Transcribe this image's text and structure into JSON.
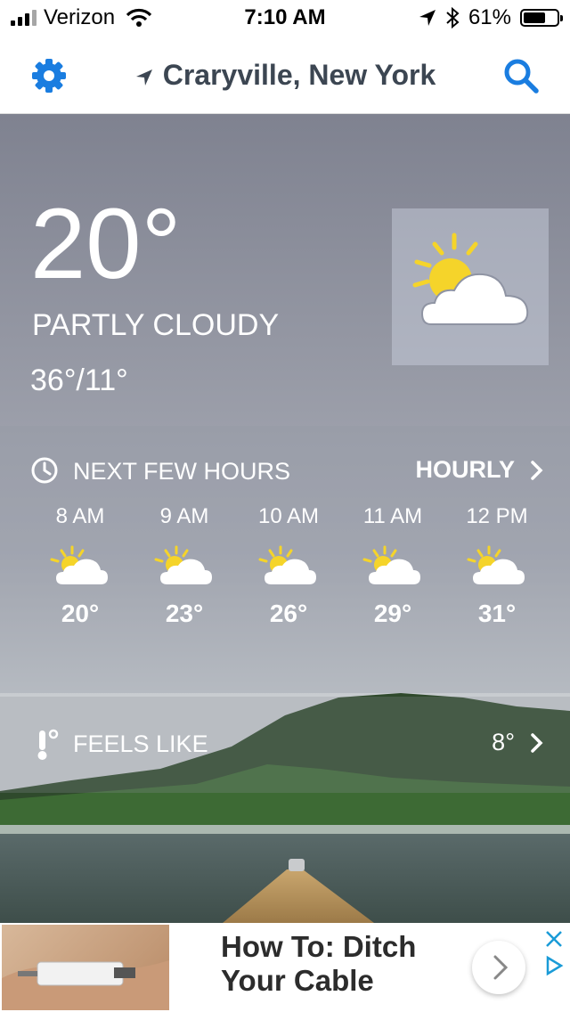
{
  "status_bar": {
    "carrier": "Verizon",
    "time": "7:10 AM",
    "battery": "61%"
  },
  "header": {
    "location": "Craryville, New York"
  },
  "current": {
    "temperature": "20°",
    "condition": "PARTLY CLOUDY",
    "hi_lo": "36°/11°"
  },
  "hourly": {
    "title": "NEXT FEW HOURS",
    "link_label": "HOURLY",
    "hours": [
      {
        "time": "8 AM",
        "temp": "20°"
      },
      {
        "time": "9 AM",
        "temp": "23°"
      },
      {
        "time": "10 AM",
        "temp": "26°"
      },
      {
        "time": "11 AM",
        "temp": "29°"
      },
      {
        "time": "12 PM",
        "temp": "31°"
      }
    ]
  },
  "feels_like": {
    "label": "FEELS LIKE",
    "value": "8°"
  },
  "ad": {
    "title": "How To: Ditch Your Cable"
  },
  "colors": {
    "accent": "#1a7de0",
    "sun": "#f5d42a"
  }
}
